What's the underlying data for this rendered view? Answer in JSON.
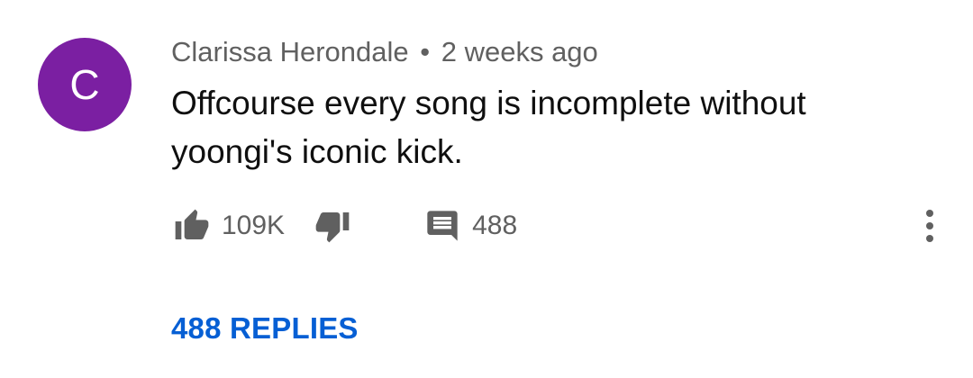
{
  "comment": {
    "avatar_letter": "C",
    "avatar_color": "#7b1fa2",
    "author": "Clarissa Herondale",
    "separator": "•",
    "time_ago": "2 weeks ago",
    "text": "Offcourse every song is incomplete without yoongi's iconic kick."
  },
  "actions": {
    "like_icon": "thumbs-up-icon",
    "like_count": "109K",
    "dislike_icon": "thumbs-down-icon",
    "reply_icon": "comment-icon",
    "reply_count": "488",
    "more_icon": "more-vertical-icon"
  },
  "replies": {
    "label": "488 REPLIES",
    "link_color": "#065fd4"
  }
}
